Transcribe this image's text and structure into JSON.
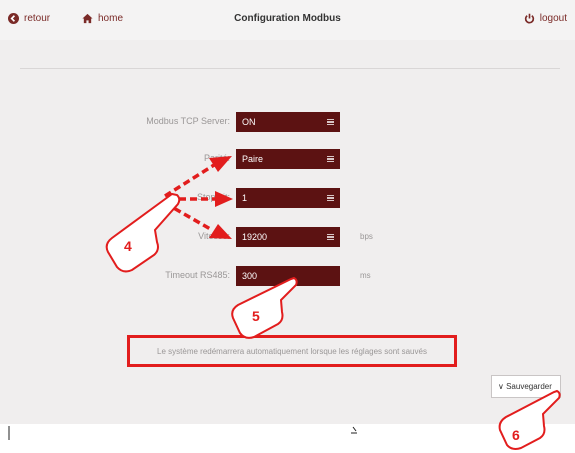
{
  "header": {
    "back_label": "retour",
    "home_label": "home",
    "title": "Configuration Modbus",
    "logout_label": "logout"
  },
  "form": {
    "tcp": {
      "label": "Modbus TCP Server:",
      "value": "ON"
    },
    "parity": {
      "label": "Parité:",
      "value": "Paire"
    },
    "stop": {
      "label": "Stop bit:",
      "value": "1"
    },
    "speed": {
      "label": "Vitesse:",
      "value": "19200",
      "unit": "bps"
    },
    "timeout": {
      "label": "Timeout RS485:",
      "value": "300",
      "unit": "ms"
    }
  },
  "notice": "Le système redémarrera automatiquement lorsque les réglages sont sauvés",
  "save_label": "Sauvegarder",
  "annotations": {
    "step4": "4",
    "step5": "5",
    "step6": "6"
  },
  "colors": {
    "accent": "#7a2a27",
    "field": "#5c1212",
    "highlight": "#e21d1d"
  }
}
